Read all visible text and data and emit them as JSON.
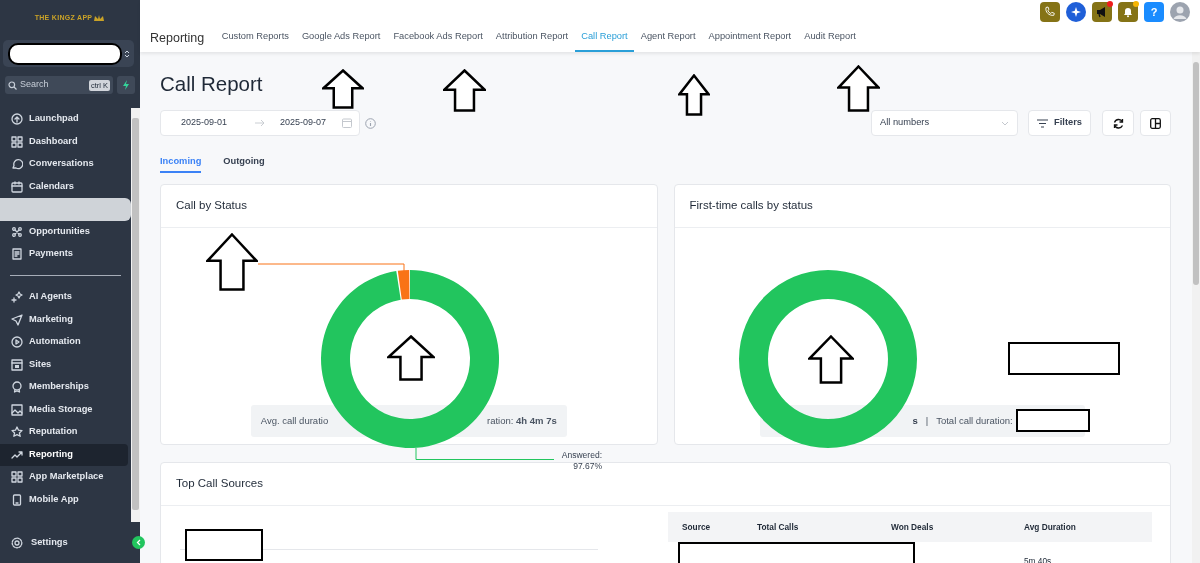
{
  "sidebar": {
    "logo": "THE KINGZ APP",
    "search": {
      "placeholder": "Search",
      "shortcut": "ctrl K"
    },
    "sections": [
      {
        "items": [
          {
            "kind": "link",
            "label": "Launchpad",
            "selected": false
          },
          {
            "kind": "link",
            "label": "Dashboard",
            "selected": false
          },
          {
            "kind": "link",
            "label": "Conversations",
            "selected": false
          },
          {
            "kind": "link",
            "label": "Calendars",
            "selected": false
          },
          {
            "kind": "blank",
            "selected": false
          },
          {
            "kind": "link",
            "label": "Opportunities",
            "selected": false
          },
          {
            "kind": "link",
            "label": "Payments",
            "selected": false
          }
        ]
      },
      {
        "items": [
          {
            "kind": "link",
            "label": "AI Agents",
            "selected": false
          },
          {
            "kind": "link",
            "label": "Marketing",
            "selected": false
          },
          {
            "kind": "link",
            "label": "Automation",
            "selected": false
          },
          {
            "kind": "link",
            "label": "Sites",
            "selected": false
          },
          {
            "kind": "link",
            "label": "Memberships",
            "selected": false
          },
          {
            "kind": "link",
            "label": "Media Storage",
            "selected": false
          },
          {
            "kind": "link",
            "label": "Reputation",
            "selected": false
          },
          {
            "kind": "link",
            "label": "Reporting",
            "selected": true
          },
          {
            "kind": "link",
            "label": "App Marketplace",
            "selected": false
          },
          {
            "kind": "link",
            "label": "Mobile App",
            "selected": false
          }
        ]
      }
    ],
    "settings": "Settings"
  },
  "header": {
    "section": "Reporting",
    "tabs": [
      {
        "label": "Custom Reports",
        "selected": false
      },
      {
        "label": "Google Ads Report",
        "selected": false
      },
      {
        "label": "Facebook Ads Report",
        "selected": false
      },
      {
        "label": "Attribution Report",
        "selected": false
      },
      {
        "label": "Call Report",
        "selected": true
      },
      {
        "label": "Agent Report",
        "selected": false
      },
      {
        "label": "Appointment Report",
        "selected": false
      },
      {
        "label": "Audit Report",
        "selected": false
      }
    ],
    "icons": [
      {
        "kind": "phone"
      },
      {
        "kind": "sparkle"
      },
      {
        "kind": "megaphone",
        "color": "#ef1c1c"
      },
      {
        "kind": "bell",
        "color": "#f5b400"
      },
      {
        "kind": "help",
        "label": "?"
      },
      {
        "kind": "avatar"
      }
    ]
  },
  "title": "Call Report",
  "date_range": {
    "start": "2025-09-01",
    "end": "2025-09-07"
  },
  "number_filter": {
    "value": "All numbers"
  },
  "filters_button": "Filters",
  "direction_tabs": [
    {
      "label": "Incoming",
      "selected": true
    },
    {
      "label": "Outgoing",
      "selected": false
    }
  ],
  "cards": [
    {
      "title": "Call by Status",
      "chart_data": {
        "type": "donut",
        "values": [
          97.67,
          2.33
        ],
        "colors": [
          "#22c55e",
          "#f97316"
        ]
      },
      "callout": {
        "label": "Answered:",
        "value": "97.67%"
      },
      "stats": [
        {
          "kind": "label",
          "text": "Avg. call duratio"
        },
        {
          "kind": "label",
          "text": "ration: **4h 4m 7s**"
        }
      ]
    },
    {
      "title": "First-time calls by status",
      "stats": [
        {
          "kind": "value",
          "text": "s"
        },
        {
          "kind": "separator",
          "text": "|"
        },
        {
          "kind": "label",
          "text": "Total call duration:"
        }
      ]
    }
  ],
  "top_call_sources": {
    "title": "Top Call Sources",
    "table": {
      "columns": [
        "Source",
        "Total Calls",
        "Won Deals",
        "Avg Duration"
      ],
      "rows": [
        {
          "avg_duration": "5m 40s"
        }
      ]
    }
  }
}
